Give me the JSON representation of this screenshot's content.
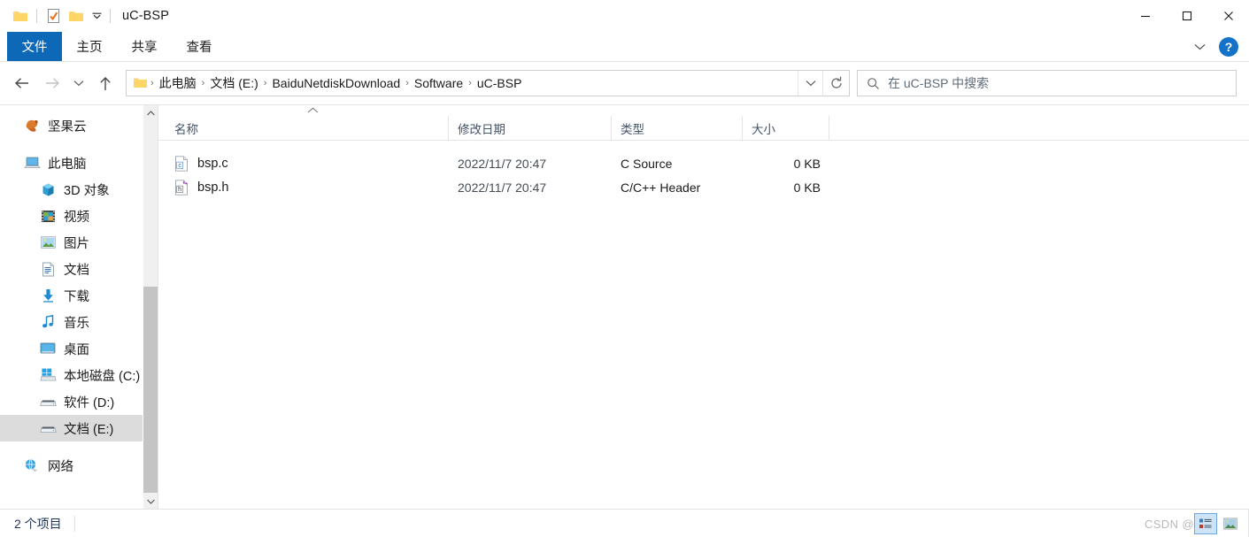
{
  "window": {
    "title": "uC-BSP",
    "quick_access": [
      {
        "name": "folder-icon",
        "label": "folder"
      },
      {
        "name": "properties-icon",
        "label": "properties"
      },
      {
        "name": "new-folder-icon",
        "label": "new folder"
      }
    ],
    "controls": {
      "minimize": "minimize",
      "maximize": "maximize",
      "close": "close"
    }
  },
  "ribbon": {
    "tabs": [
      {
        "label": "文件",
        "active": true
      },
      {
        "label": "主页",
        "active": false
      },
      {
        "label": "共享",
        "active": false
      },
      {
        "label": "查看",
        "active": false
      }
    ],
    "expand_label": "展开功能区",
    "help_label": "?"
  },
  "nav": {
    "back": "后退",
    "forward": "前进",
    "recent": "最近使用的位置",
    "up": "向上"
  },
  "address": {
    "crumbs": [
      "此电脑",
      "文档 (E:)",
      "BaiduNetdiskDownload",
      "Software",
      "uC-BSP"
    ],
    "separator": "›",
    "dropdown": "历史位置",
    "refresh": "刷新"
  },
  "search": {
    "placeholder": "在 uC-BSP 中搜索"
  },
  "sidebar": {
    "items": [
      {
        "label": "坚果云",
        "icon": "acorn-icon",
        "level": 0,
        "selected": false,
        "gap_after": true
      },
      {
        "label": "此电脑",
        "icon": "this-pc-icon",
        "level": 0,
        "selected": false,
        "gap_after": false
      },
      {
        "label": "3D 对象",
        "icon": "3d-objects-icon",
        "level": 1,
        "selected": false,
        "gap_after": false
      },
      {
        "label": "视频",
        "icon": "videos-icon",
        "level": 1,
        "selected": false,
        "gap_after": false
      },
      {
        "label": "图片",
        "icon": "pictures-icon",
        "level": 1,
        "selected": false,
        "gap_after": false
      },
      {
        "label": "文档",
        "icon": "documents-icon",
        "level": 1,
        "selected": false,
        "gap_after": false
      },
      {
        "label": "下载",
        "icon": "downloads-icon",
        "level": 1,
        "selected": false,
        "gap_after": false
      },
      {
        "label": "音乐",
        "icon": "music-icon",
        "level": 1,
        "selected": false,
        "gap_after": false
      },
      {
        "label": "桌面",
        "icon": "desktop-icon",
        "level": 1,
        "selected": false,
        "gap_after": false
      },
      {
        "label": "本地磁盘 (C:)",
        "icon": "system-drive-icon",
        "level": 1,
        "selected": false,
        "gap_after": false
      },
      {
        "label": "软件 (D:)",
        "icon": "drive-icon",
        "level": 1,
        "selected": false,
        "gap_after": false
      },
      {
        "label": "文档 (E:)",
        "icon": "drive-icon",
        "level": 1,
        "selected": true,
        "gap_after": true
      },
      {
        "label": "网络",
        "icon": "network-icon",
        "level": 0,
        "selected": false,
        "gap_after": false
      }
    ]
  },
  "filelist": {
    "columns": [
      {
        "label": "名称",
        "key": "name"
      },
      {
        "label": "修改日期",
        "key": "date"
      },
      {
        "label": "类型",
        "key": "type"
      },
      {
        "label": "大小",
        "key": "size"
      }
    ],
    "sort_indicator": "⌃",
    "rows": [
      {
        "name": "bsp.c",
        "date": "2022/11/7 20:47",
        "type": "C Source",
        "size": "0 KB",
        "icon": "c-source-file-icon"
      },
      {
        "name": "bsp.h",
        "date": "2022/11/7 20:47",
        "type": "C/C++ Header",
        "size": "0 KB",
        "icon": "cpp-header-file-icon"
      }
    ]
  },
  "status": {
    "item_count": "2 个项目",
    "watermark": "CSDN @",
    "views": [
      {
        "name": "details-view",
        "active": true
      },
      {
        "name": "large-icons-view",
        "active": false
      }
    ]
  },
  "colors": {
    "accent": "#0d68b8",
    "help": "#1473c8",
    "selection": "#dcdcdc",
    "header_text": "#44546a",
    "status_text": "#1f3556"
  }
}
